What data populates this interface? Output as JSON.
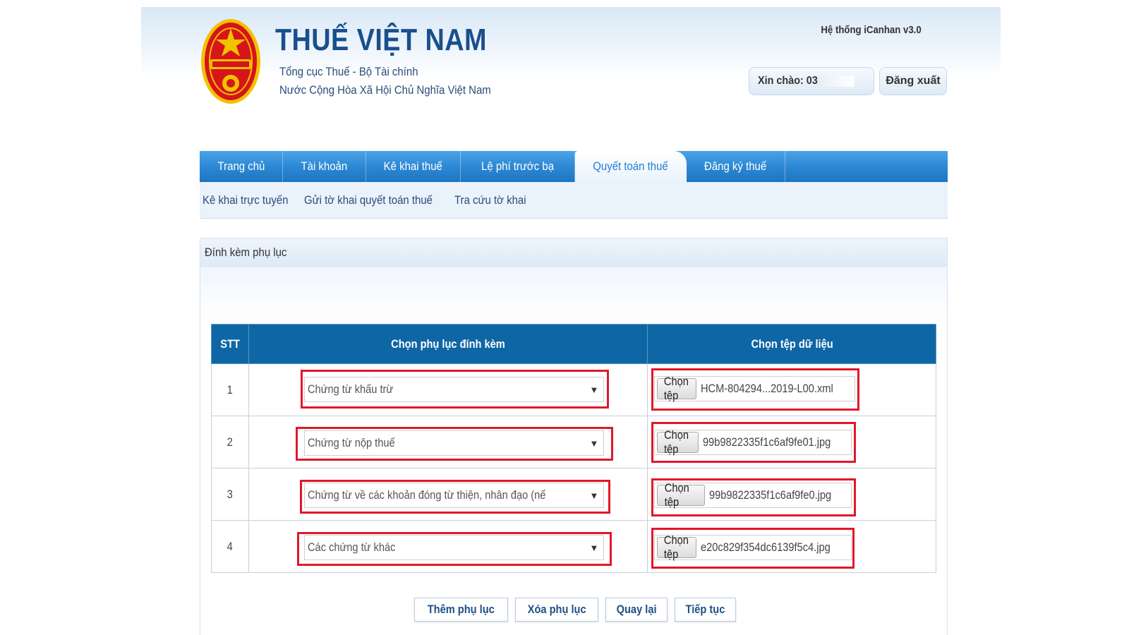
{
  "header": {
    "title": "THUẾ VIỆT NAM",
    "subtitle1": "Tổng cục Thuế - Bộ Tài chính",
    "subtitle2": "Nước Cộng Hòa Xã Hội Chủ Nghĩa Việt Nam",
    "logo_icon": "national-emblem-icon",
    "system_version": "Hệ thống iCanhan v3.0",
    "greeting_label": "Xin chào: 03",
    "logout_label": "Đăng xuất"
  },
  "nav": {
    "tabs": [
      {
        "label": "Trang chủ"
      },
      {
        "label": "Tài khoản"
      },
      {
        "label": "Kê khai thuế"
      },
      {
        "label": "Lệ phí trước bạ"
      },
      {
        "label": "Quyết toán thuế"
      },
      {
        "label": "Đăng ký thuế"
      }
    ],
    "active_tab": "Quyết toán thuế",
    "subnav": [
      {
        "label": "Kê khai trực tuyến"
      },
      {
        "label": "Gửi tờ khai quyết toán thuế"
      },
      {
        "label": "Tra cứu tờ khai"
      }
    ]
  },
  "panel": {
    "title": "Đính kèm phụ lục",
    "table": {
      "headers": [
        "STT",
        "Chọn phụ lục đính kèm",
        "Chọn tệp dữ liệu"
      ],
      "rows": [
        {
          "stt": "1",
          "appendix": "Chứng từ khấu trừ",
          "file_button": "Chọn tệp",
          "file_name": "HCM-804294...2019-L00.xml"
        },
        {
          "stt": "2",
          "appendix": "Chứng từ nộp thuế",
          "file_button": "Chọn tệp",
          "file_name": "99b9822335f1c6af9fe01.jpg"
        },
        {
          "stt": "3",
          "appendix": "Chứng từ về các khoản đóng từ thiện, nhân đạo (nếu có)",
          "file_button": "Chọn tệp",
          "file_name": "99b9822335f1c6af9fe0.jpg"
        },
        {
          "stt": "4",
          "appendix": "Các chứng từ khác",
          "file_button": "Chọn tệp",
          "file_name": "e20c829f354dc6139f5c4.jpg"
        }
      ]
    },
    "actions": {
      "add": "Thêm phụ lục",
      "delete": "Xóa phụ lục",
      "back": "Quay lại",
      "next": "Tiếp tục"
    }
  },
  "colors": {
    "brand_blue": "#1a4f8c",
    "nav_blue": "#2b86d2",
    "table_header": "#0f66a5",
    "highlight_red": "#e0182a"
  }
}
